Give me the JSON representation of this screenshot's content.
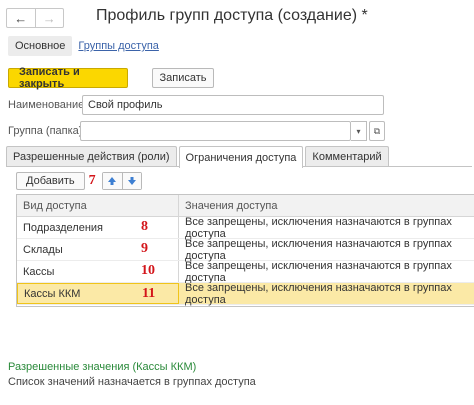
{
  "window": {
    "title": "Профиль групп доступа (создание) *"
  },
  "nav": {
    "back_icon": "←",
    "forward_icon": "→"
  },
  "subtabs": {
    "main": "Основное",
    "link": "Группы доступа"
  },
  "toolbar": {
    "save_close_label": "Записать и закрыть",
    "save_label": "Записать"
  },
  "form": {
    "name_label": "Наименование:",
    "name_value": "Свой профиль",
    "group_label": "Группа (папка):",
    "group_value": "",
    "select_icon": "▾",
    "open_icon": "⧉"
  },
  "tabs": [
    {
      "label": "Разрешенные действия (роли)"
    },
    {
      "label": "Ограничения доступа"
    },
    {
      "label": "Комментарий"
    }
  ],
  "panel": {
    "add_label": "Добавить",
    "marker_add": "7",
    "up_icon": "up-arrow-icon",
    "down_icon": "down-arrow-icon",
    "accent_color": "#3d7fd2"
  },
  "grid": {
    "columns": [
      "Вид доступа",
      "Значения доступа"
    ],
    "rows": [
      {
        "kind": "Подразделения",
        "values": "Все запрещены, исключения назначаются в группах доступа",
        "marker": "8",
        "selected": false
      },
      {
        "kind": "Склады",
        "values": "Все запрещены, исключения назначаются в группах доступа",
        "marker": "9",
        "selected": false
      },
      {
        "kind": "Кассы",
        "values": "Все запрещены, исключения назначаются в группах доступа",
        "marker": "10",
        "selected": false
      },
      {
        "kind": "Кассы ККМ",
        "values": "Все запрещены, исключения назначаются в группах доступа",
        "marker": "11",
        "selected": true
      }
    ]
  },
  "footer": {
    "title": "Разрешенные значения (Кассы ККМ)",
    "text": "Список значений назначается в группах доступа"
  },
  "colors": {
    "primary_button": "#fbd700",
    "selected_row": "#fbe9a6",
    "link": "#3b63a9",
    "marker": "#d3151a",
    "footer_title": "#2a8a3a"
  }
}
